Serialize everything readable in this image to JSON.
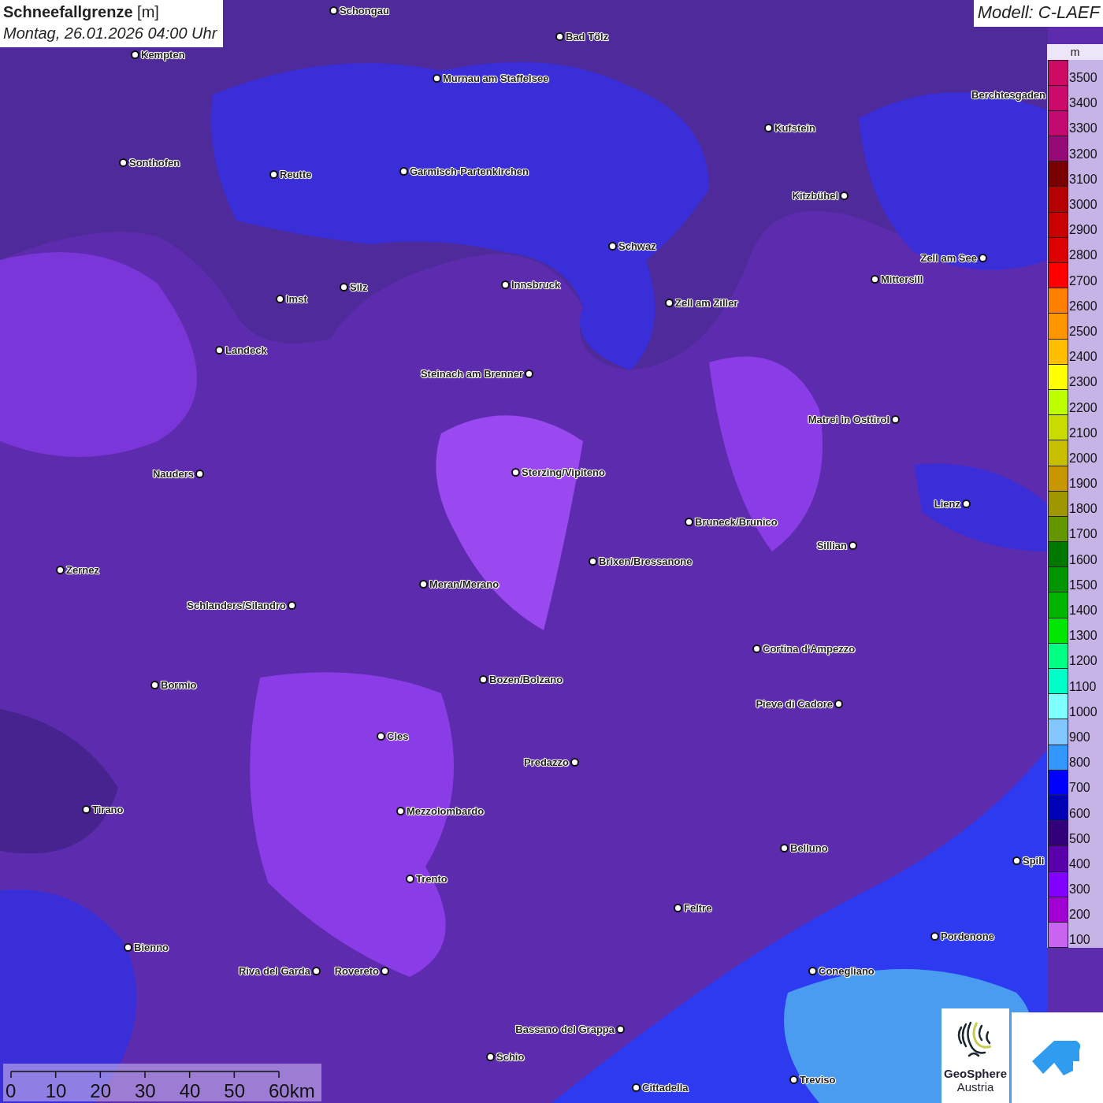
{
  "title": {
    "heading": "**Schneefallgrenze** [m]",
    "datetime": "Montag, 26.01.2026 04:00 Uhr"
  },
  "model": "Modell: C-LAEF",
  "cities": [
    {
      "name": "Schongau"
    },
    {
      "name": "Kempten"
    },
    {
      "name": "Bad Tölz"
    },
    {
      "name": "Murnau am Staffelsee"
    },
    {
      "name": "Berchtesgaden"
    },
    {
      "name": "Kufstein"
    },
    {
      "name": "Sonthofen"
    },
    {
      "name": "Reutte"
    },
    {
      "name": "Garmisch-Partenkirchen"
    },
    {
      "name": "Kitzbühel"
    },
    {
      "name": "Schwaz"
    },
    {
      "name": "Zell am See"
    },
    {
      "name": "Mittersill"
    },
    {
      "name": "Innsbruck"
    },
    {
      "name": "Imst"
    },
    {
      "name": "Silz"
    },
    {
      "name": "Zell am Ziller"
    },
    {
      "name": "Landeck"
    },
    {
      "name": "Steinach am Brenner"
    },
    {
      "name": "Matrei in Osttirol"
    },
    {
      "name": "Nauders"
    },
    {
      "name": "Sterzing/Vipiteno"
    },
    {
      "name": "Lienz"
    },
    {
      "name": "Bruneck/Brunico"
    },
    {
      "name": "Sillian"
    },
    {
      "name": "Brixen/Bressanone"
    },
    {
      "name": "Zernez"
    },
    {
      "name": "Meran/Merano"
    },
    {
      "name": "Schlanders/Silandro"
    },
    {
      "name": "Cortina d'Ampezzo"
    },
    {
      "name": "Bozen/Bolzano"
    },
    {
      "name": "Bormio"
    },
    {
      "name": "Pieve di Cadore"
    },
    {
      "name": "Cles"
    },
    {
      "name": "Predazzo"
    },
    {
      "name": "Tirano"
    },
    {
      "name": "Mezzolombardo"
    },
    {
      "name": "Belluno"
    },
    {
      "name": "Spili"
    },
    {
      "name": "Trento"
    },
    {
      "name": "Feltre"
    },
    {
      "name": "Pordenone"
    },
    {
      "name": "Bienno"
    },
    {
      "name": "Riva del Garda"
    },
    {
      "name": "Rovereto"
    },
    {
      "name": "Conegliano"
    },
    {
      "name": "Bassano del Grappa"
    },
    {
      "name": "Schio"
    },
    {
      "name": "Treviso"
    },
    {
      "name": "Cittadella"
    }
  ],
  "legend": {
    "unit": "m",
    "items": [
      {
        "label": "3500",
        "color": "#cf0a64"
      },
      {
        "label": "3400",
        "color": "#cc0a6c"
      },
      {
        "label": "3300",
        "color": "#c20a70"
      },
      {
        "label": "3200",
        "color": "#960a78"
      },
      {
        "label": "3100",
        "color": "#780000"
      },
      {
        "label": "3000",
        "color": "#b40000"
      },
      {
        "label": "2900",
        "color": "#c80000"
      },
      {
        "label": "2800",
        "color": "#dc0000"
      },
      {
        "label": "2700",
        "color": "#ff0000"
      },
      {
        "label": "2600",
        "color": "#ff8000"
      },
      {
        "label": "2500",
        "color": "#ff9600"
      },
      {
        "label": "2400",
        "color": "#ffbe00"
      },
      {
        "label": "2300",
        "color": "#ffff00"
      },
      {
        "label": "2200",
        "color": "#beff00"
      },
      {
        "label": "2100",
        "color": "#c8dc00"
      },
      {
        "label": "2000",
        "color": "#c8be00"
      },
      {
        "label": "1900",
        "color": "#c89600"
      },
      {
        "label": "1800",
        "color": "#a09600"
      },
      {
        "label": "1700",
        "color": "#649600"
      },
      {
        "label": "1600",
        "color": "#007800"
      },
      {
        "label": "1500",
        "color": "#009600"
      },
      {
        "label": "1400",
        "color": "#00b400"
      },
      {
        "label": "1300",
        "color": "#00e600"
      },
      {
        "label": "1200",
        "color": "#00ff82"
      },
      {
        "label": "1100",
        "color": "#00ffc8"
      },
      {
        "label": "1000",
        "color": "#80ffff"
      },
      {
        "label": "900",
        "color": "#82c8ff"
      },
      {
        "label": "800",
        "color": "#3296ff"
      },
      {
        "label": "700",
        "color": "#0000ff"
      },
      {
        "label": "600",
        "color": "#0000b4"
      },
      {
        "label": "500",
        "color": "#320078"
      },
      {
        "label": "400",
        "color": "#5a00aa"
      },
      {
        "label": "300",
        "color": "#8200ff"
      },
      {
        "label": "200",
        "color": "#a000d2"
      },
      {
        "label": "100",
        "color": "#c864f0"
      }
    ]
  },
  "scale_bar": {
    "labels": [
      "0",
      "10",
      "20",
      "30",
      "40",
      "50",
      "60km"
    ]
  },
  "logo": {
    "name": "GeoSphere",
    "subtitle": "Austria"
  }
}
